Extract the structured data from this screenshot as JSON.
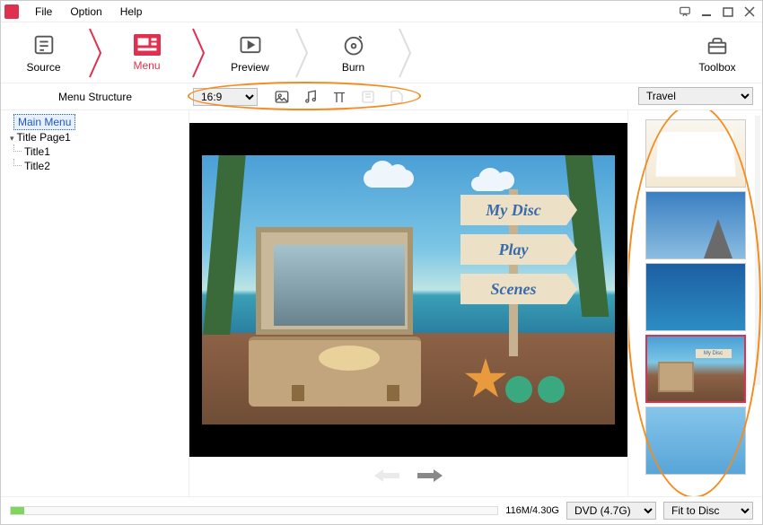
{
  "menubar": {
    "file": "File",
    "option": "Option",
    "help": "Help"
  },
  "steps": {
    "source": "Source",
    "menu": "Menu",
    "preview": "Preview",
    "burn": "Burn",
    "toolbox": "Toolbox"
  },
  "subtoolbar": {
    "structure_label": "Menu Structure",
    "aspect": "16:9"
  },
  "template_category": "Travel",
  "tree": {
    "main_menu": "Main Menu",
    "title_page": "Title Page1",
    "title1": "Title1",
    "title2": "Title2"
  },
  "menu_buttons": {
    "disc": "My Disc",
    "play": "Play",
    "scenes": "Scenes"
  },
  "thumb_labels": {
    "mydisc": "My Disc"
  },
  "status": {
    "size": "116M/4.30G",
    "disc_type": "DVD (4.7G)",
    "fit": "Fit to Disc"
  }
}
